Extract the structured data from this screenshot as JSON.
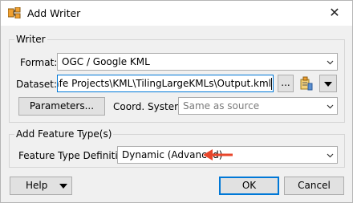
{
  "window": {
    "title": "Add Writer",
    "close_glyph": "✕"
  },
  "writer_group": {
    "legend": "Writer",
    "format_label": "Format:",
    "format_value": "OGC / Google KML",
    "dataset_label": "Dataset:",
    "dataset_value": "cuments\\Safe Projects\\KML\\TilingLargeKMLs\\Output.kml",
    "browse_label": "...",
    "parameters_label": "Parameters...",
    "coord_label": "Coord. System:",
    "coord_placeholder": "Same as source"
  },
  "feature_group": {
    "legend": "Add Feature Type(s)",
    "definition_label": "Feature Type Definition:",
    "definition_value": "Dynamic (Advanced)"
  },
  "footer": {
    "help_label": "Help",
    "ok_label": "OK",
    "cancel_label": "Cancel"
  },
  "icons": [
    "writer-icon",
    "close-icon",
    "chevron-down-icon",
    "file-browse-icon",
    "arrow-left-icon"
  ],
  "colors": {
    "accent": "#0078d7",
    "arrow": "#e8462b",
    "background": "#f0f0f0"
  }
}
